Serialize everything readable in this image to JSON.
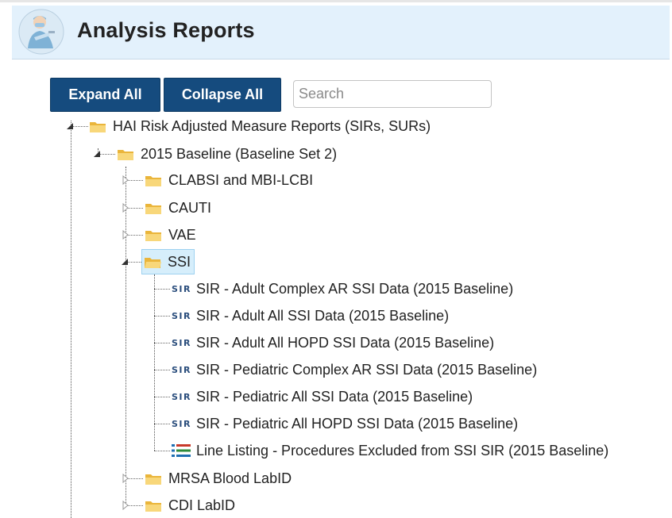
{
  "header": {
    "title": "Analysis Reports"
  },
  "toolbar": {
    "expand_all_label": "Expand All",
    "collapse_all_label": "Collapse All",
    "search_placeholder": "Search"
  },
  "tree": {
    "root": {
      "label": "HAI Risk Adjusted Measure Reports (SIRs, SURs)",
      "expanded": true
    },
    "baseline": {
      "label": "2015 Baseline (Baseline Set 2)",
      "expanded": true
    },
    "folders": [
      {
        "label": "CLABSI and MBI-LCBI",
        "expanded": false
      },
      {
        "label": "CAUTI",
        "expanded": false
      },
      {
        "label": "VAE",
        "expanded": false
      },
      {
        "label": "SSI",
        "expanded": true,
        "selected": true
      },
      {
        "label": "MRSA Blood LabID",
        "expanded": false
      },
      {
        "label": "CDI LabID",
        "expanded": false
      }
    ],
    "ssi_reports": [
      {
        "badge": "SIR",
        "icon": "sir-icon",
        "label": "SIR - Adult Complex AR SSI Data (2015 Baseline)"
      },
      {
        "badge": "SIR",
        "icon": "sir-icon",
        "label": "SIR - Adult All SSI Data (2015 Baseline)"
      },
      {
        "badge": "SIR",
        "icon": "sir-icon",
        "label": "SIR - Adult All HOPD SSI Data (2015 Baseline)"
      },
      {
        "badge": "SIR",
        "icon": "sir-icon",
        "label": "SIR - Pediatric Complex AR SSI Data (2015 Baseline)"
      },
      {
        "badge": "SIR",
        "icon": "sir-icon",
        "label": "SIR - Pediatric All SSI Data (2015 Baseline)"
      },
      {
        "badge": "SIR",
        "icon": "sir-icon",
        "label": "SIR - Pediatric All HOPD SSI Data (2015 Baseline)"
      },
      {
        "badge": "",
        "icon": "line-listing-icon",
        "label": "Line Listing - Procedures Excluded from SSI SIR (2015 Baseline)"
      }
    ]
  },
  "colors": {
    "header_bg": "#e3f1fc",
    "button_bg": "#154b7e",
    "folder": "#f3c34d",
    "selected_bg": "#d6eefb",
    "sir_badge": "#2a4d7c"
  }
}
